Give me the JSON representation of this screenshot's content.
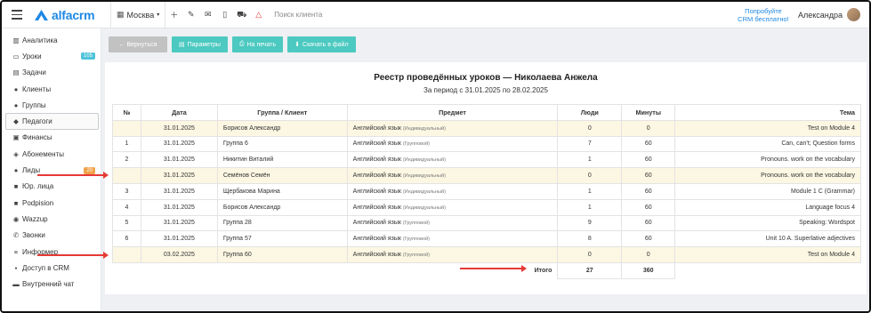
{
  "header": {
    "logo_text": "alfacrm",
    "city": "Москва",
    "search_placeholder": "Поиск клиента",
    "promo": [
      "Попробуйте",
      "CRM бесплатно!"
    ],
    "user_name": "Александра"
  },
  "sidebar": {
    "items": [
      {
        "label": "Аналитика",
        "icon": "chart-icon"
      },
      {
        "label": "Уроки",
        "icon": "calendar-icon",
        "badge": "105"
      },
      {
        "label": "Задачи",
        "icon": "clipboard-icon"
      },
      {
        "label": "Клиенты",
        "icon": "user-icon"
      },
      {
        "label": "Группы",
        "icon": "users-icon"
      },
      {
        "label": "Педагоги",
        "icon": "graduation-cap-icon"
      },
      {
        "label": "Финансы",
        "icon": "money-icon"
      },
      {
        "label": "Абонементы",
        "icon": "tag-icon"
      },
      {
        "label": "Лиды",
        "icon": "user-plus-icon",
        "badge": "20"
      },
      {
        "label": "Юр. лица",
        "icon": "briefcase-icon"
      },
      {
        "label": "Podpision",
        "icon": "document-icon"
      },
      {
        "label": "Wazzup",
        "icon": "whatsapp-icon"
      },
      {
        "label": "Звонки",
        "icon": "phone-icon"
      },
      {
        "label": "Информер",
        "icon": "list-icon"
      },
      {
        "label": "Доступ в CRM",
        "icon": "lock-icon"
      },
      {
        "label": "Внутренний чат",
        "icon": "chat-icon"
      }
    ]
  },
  "toolbar": {
    "back": "← Вернуться",
    "params": "Параметры",
    "print": "На печать",
    "download": "Скачать в файл"
  },
  "report": {
    "title": "Реестр проведённых уроков — Николаева Анжела",
    "subtitle": "За период с 31.01.2025 по 28.02.2025",
    "columns": [
      "№",
      "Дата",
      "Группа / Клиент",
      "Предмет",
      "Люди",
      "Минуты",
      "Тема"
    ],
    "rows": [
      {
        "num": "",
        "date": "31.01.2025",
        "client": "Борисов Александр",
        "subject": "Английский язык",
        "type": "(Индивидуальный)",
        "people": "0",
        "minutes": "0",
        "topic": "Test on Module 4",
        "hl": true
      },
      {
        "num": "1",
        "date": "31.01.2025",
        "client": "Группа 6",
        "subject": "Английский язык",
        "type": "(Групповой)",
        "people": "7",
        "minutes": "60",
        "topic": "Can, can't; Question forms",
        "hl": false
      },
      {
        "num": "2",
        "date": "31.01.2025",
        "client": "Никитин Виталий",
        "subject": "Английский язык",
        "type": "(Индивидуальный)",
        "people": "1",
        "minutes": "60",
        "topic": "Pronouns. work on the vocabulary",
        "hl": false
      },
      {
        "num": "",
        "date": "31.01.2025",
        "client": "Семёнов Семён",
        "subject": "Английский язык",
        "type": "(Индивидуальный)",
        "people": "0",
        "minutes": "60",
        "topic": "Pronouns. work on the vocabulary",
        "hl": true
      },
      {
        "num": "3",
        "date": "31.01.2025",
        "client": "Щербакова Марина",
        "subject": "Английский язык",
        "type": "(Индивидуальный)",
        "people": "1",
        "minutes": "60",
        "topic": "Module 1 C (Grammar)",
        "hl": false
      },
      {
        "num": "4",
        "date": "31.01.2025",
        "client": "Борисов Александр",
        "subject": "Английский язык",
        "type": "(Индивидуальный)",
        "people": "1",
        "minutes": "60",
        "topic": "Language focus 4",
        "hl": false
      },
      {
        "num": "5",
        "date": "31.01.2025",
        "client": "Группа 28",
        "subject": "Английский язык",
        "type": "(Групповой)",
        "people": "9",
        "minutes": "60",
        "topic": "Speaking: Wordspot",
        "hl": false
      },
      {
        "num": "6",
        "date": "31.01.2025",
        "client": "Группа 57",
        "subject": "Английский язык",
        "type": "(Групповой)",
        "people": "8",
        "minutes": "60",
        "topic": "Unit 10 A. Superlative adjectives",
        "hl": false
      },
      {
        "num": "",
        "date": "03.02.2025",
        "client": "Группа 60",
        "subject": "Английский язык",
        "type": "(Групповой)",
        "people": "0",
        "minutes": "0",
        "topic": "Test on Module 4",
        "hl": true
      }
    ],
    "total_label": "Итого",
    "total_people": "27",
    "total_minutes": "360"
  },
  "colors": {
    "brand": "#1e88e5",
    "button_teal": "#4cc9c0",
    "highlight_row": "#fcf7e3",
    "annotation_arrow": "#e53935"
  }
}
